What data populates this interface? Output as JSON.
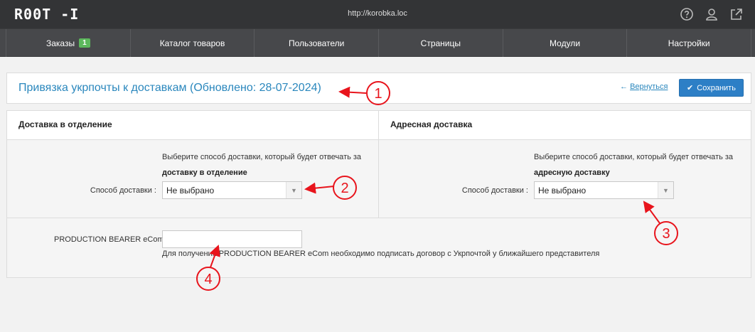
{
  "topbar": {
    "logo": "R00T -I",
    "url": "http://korobka.loc",
    "icons": [
      "help-icon",
      "user-icon",
      "external-link-icon"
    ]
  },
  "nav": {
    "items": [
      {
        "label": "Заказы",
        "badge": "1"
      },
      {
        "label": "Каталог товаров"
      },
      {
        "label": "Пользователи"
      },
      {
        "label": "Страницы"
      },
      {
        "label": "Модули"
      },
      {
        "label": "Настройки"
      }
    ]
  },
  "header": {
    "title": "Привязка укрпочты к доставкам (Обновлено: 28-07-2024)",
    "back_arrow": "←",
    "back_label": "Вернуться",
    "save_label": "Сохранить"
  },
  "left": {
    "heading": "Доставка в отделение",
    "hint_text": "Выберите способ доставки, который будет отвечать за",
    "hint_bold": "доставку в отделение",
    "field_label": "Способ доставки :",
    "select_value": "Не выбрано"
  },
  "right": {
    "heading": "Адресная доставка",
    "hint_text": "Выберите способ доставки, который будет отвечать за",
    "hint_bold": "адресную доставку",
    "field_label": "Способ доставки :",
    "select_value": "Не выбрано"
  },
  "bearer": {
    "label": "PRODUCTION BEARER eCom:",
    "value": "",
    "help": "Для получения PRODUCTION BEARER eCom необходимо подписать договор с Укрпочтой у ближайшего представителя"
  },
  "annotations": {
    "color": "#e8141c",
    "markers": [
      "1",
      "2",
      "3",
      "4"
    ]
  }
}
